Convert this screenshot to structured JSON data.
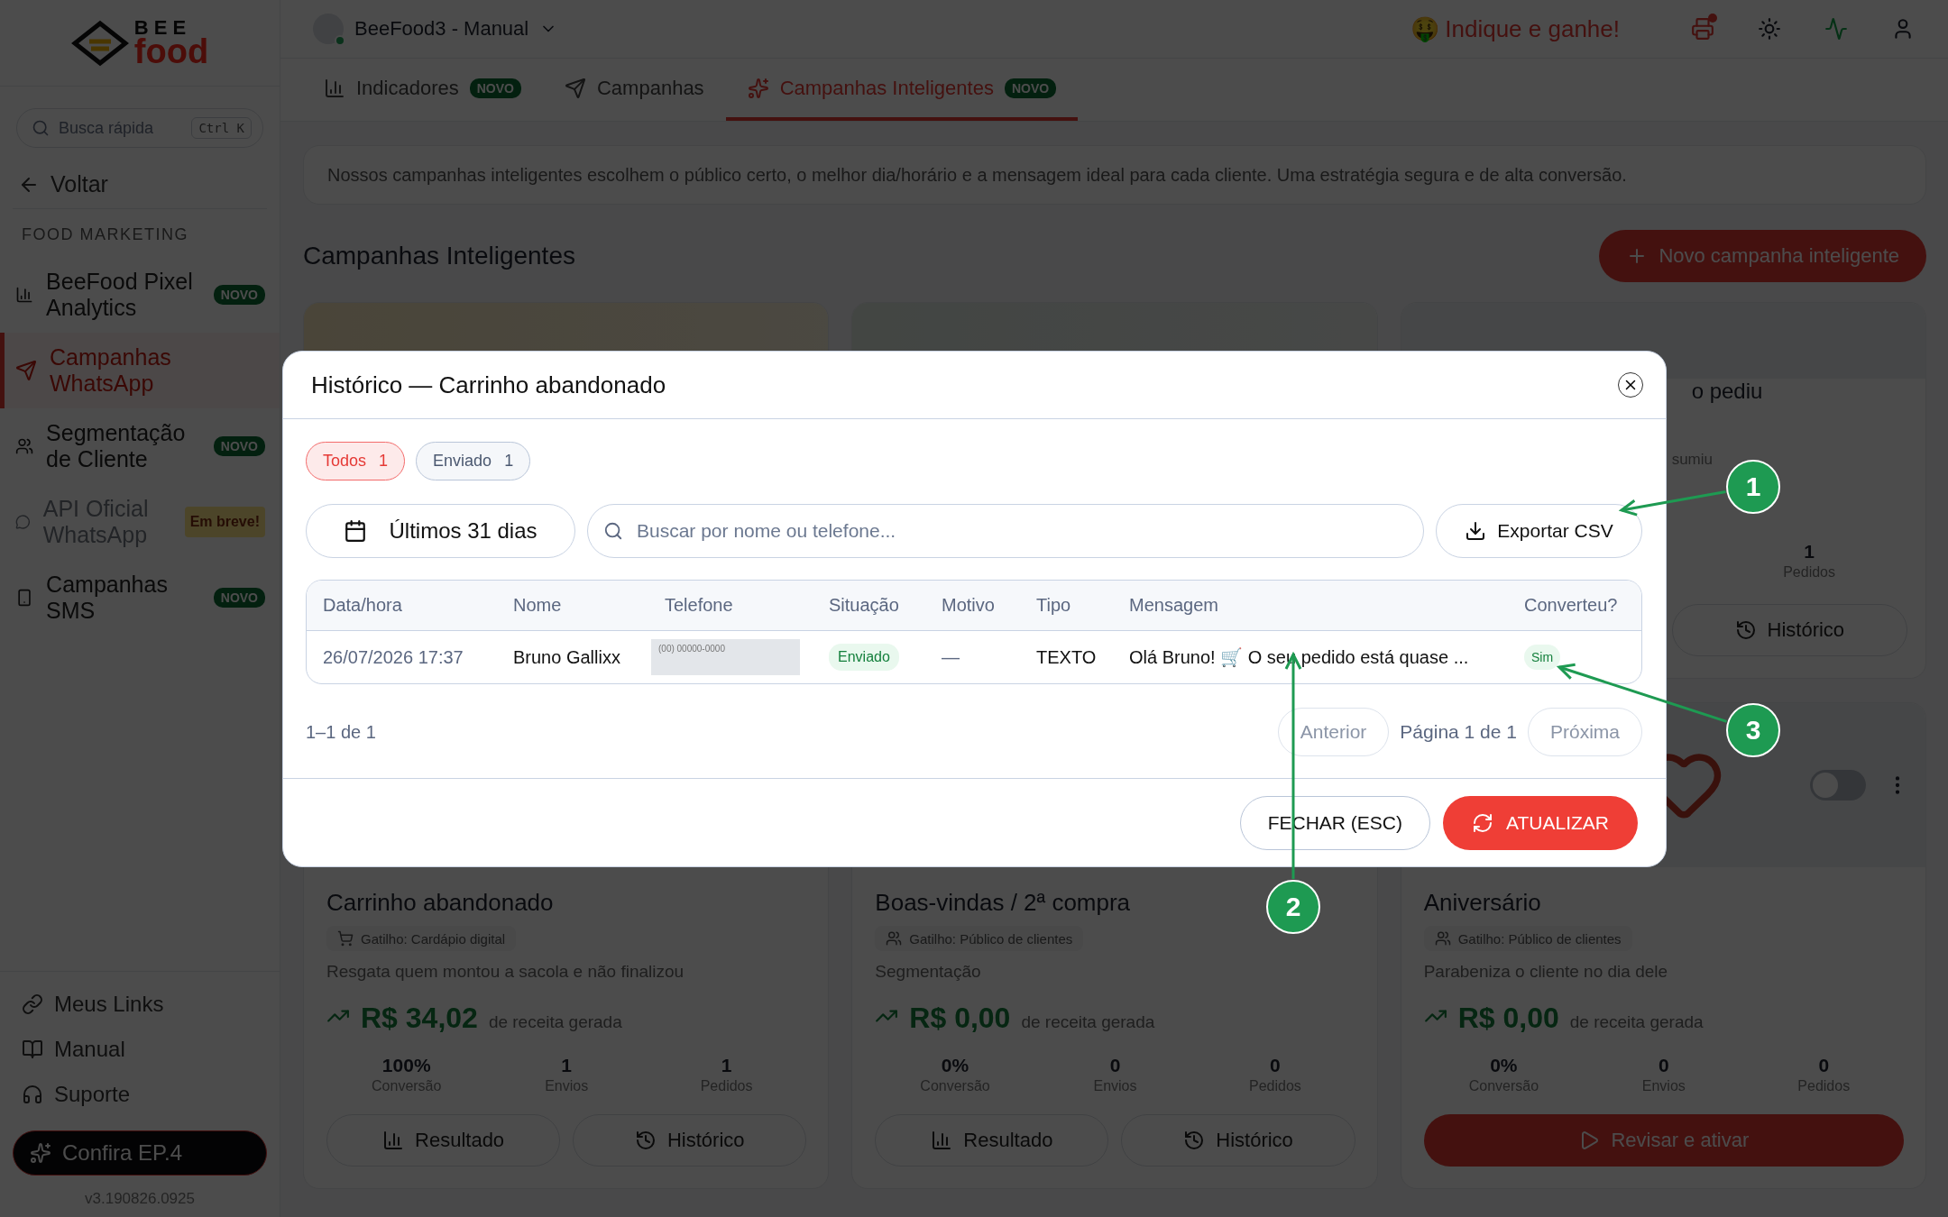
{
  "sidebar": {
    "logo": {
      "line_1": "BEE",
      "line_2": "food"
    },
    "search": {
      "placeholder": "Busca rápida",
      "shortcut": "Ctrl K"
    },
    "back": "Voltar",
    "section": "FOOD MARKETING",
    "items": [
      {
        "label": "BeeFood Pixel Analytics",
        "badge": "NOVO",
        "selected": false,
        "disabled": false
      },
      {
        "label": "Campanhas WhatsApp",
        "selected": true,
        "disabled": false
      },
      {
        "label": "Segmentação de Cliente",
        "badge": "NOVO",
        "selected": false,
        "disabled": false
      },
      {
        "label": "API Oficial WhatsApp",
        "badge": "Em breve!",
        "selected": false,
        "disabled": true
      },
      {
        "label": "Campanhas SMS",
        "badge": "NOVO",
        "selected": false,
        "disabled": false
      }
    ],
    "footer_links": [
      {
        "label": "Meus Links"
      },
      {
        "label": "Manual"
      },
      {
        "label": "Suporte"
      }
    ],
    "promo_button": "Confira EP.4",
    "version": "v3.190826.0925"
  },
  "topbar": {
    "workspace": "BeeFood3 - Manual",
    "referral": {
      "emoji": "🤑",
      "label": "Indique e ganhe!"
    },
    "printer_alert": true
  },
  "tabs": [
    {
      "label": "Indicadores",
      "badge": "NOVO",
      "selected": false
    },
    {
      "label": "Campanhas",
      "selected": false
    },
    {
      "label": "Campanhas Inteligentes",
      "badge": "NOVO",
      "selected": true
    }
  ],
  "banner": "Nossos campanhas inteligentes escolhem o público certo, o melhor dia/horário e a mensagem ideal para cada cliente. Uma estratégia segura e de alta conversão.",
  "section_title": "Campanhas Inteligentes",
  "new_button": "Novo campanha inteligente",
  "partial_card": {
    "title": "o pediu",
    "description": "sumiu",
    "stat": {
      "value": "1",
      "label": "Pedidos"
    },
    "button": "Histórico"
  },
  "campaign_cards": [
    {
      "title": "Carrinho abandonado",
      "trigger": "Gatilho: Cardápio digital",
      "description": "Resgata quem montou a sacola e não finalizou",
      "revenue": "R$ 34,02",
      "revenue_label": "de receita gerada",
      "stats": [
        {
          "value": "100%",
          "label": "Conversão"
        },
        {
          "value": "1",
          "label": "Envios"
        },
        {
          "value": "1",
          "label": "Pedidos"
        }
      ],
      "kind": "review",
      "buttons": [
        "Resultado",
        "Histórico"
      ]
    },
    {
      "title": "Boas-vindas / 2ª compra",
      "trigger": "Gatilho: Público de clientes",
      "description": "Segmentação",
      "revenue": "R$ 0,00",
      "revenue_label": "de receita gerada",
      "stats": [
        {
          "value": "0%",
          "label": "Conversão"
        },
        {
          "value": "0",
          "label": "Envios"
        },
        {
          "value": "0",
          "label": "Pedidos"
        }
      ],
      "kind": "review",
      "buttons": [
        "Resultado",
        "Histórico"
      ]
    },
    {
      "title": "Aniversário",
      "trigger": "Gatilho: Público de clientes",
      "description": "Parabeniza o cliente no dia dele",
      "revenue": "R$ 0,00",
      "revenue_label": "de receita gerada",
      "stats": [
        {
          "value": "0%",
          "label": "Conversão"
        },
        {
          "value": "0",
          "label": "Envios"
        },
        {
          "value": "0",
          "label": "Pedidos"
        }
      ],
      "kind": "activate",
      "buttons": [
        "Revisar e ativar"
      ],
      "on": false
    }
  ],
  "modal": {
    "title": "Histórico — Carrinho abandonado",
    "filters": [
      {
        "label": "Todos",
        "count": "1",
        "selected": true
      },
      {
        "label": "Enviado",
        "count": "1",
        "selected": false
      }
    ],
    "date_range": "Últimos 31 dias",
    "search": {
      "placeholder": "Buscar por nome ou telefone..."
    },
    "export_button": "Exportar CSV",
    "table": {
      "columns": [
        "Data/hora",
        "Nome",
        "Telefone",
        "Situação",
        "Motivo",
        "Tipo",
        "Mensagem",
        "Converteu?"
      ],
      "rows": [
        {
          "datetime": "26/07/2026 17:37",
          "name": "Bruno Gallixx",
          "phone": "(00) 00000-0000",
          "status": "Enviado",
          "reason": "—",
          "type": "TEXTO",
          "message": "Olá Bruno! 🛒 O seu pedido está quase ...",
          "converted": "Sim"
        }
      ]
    },
    "range": "1–1 de 1",
    "prev": {
      "label": "Anterior",
      "disabled": true
    },
    "page": "Página 1 de 1",
    "next": {
      "label": "Próxima",
      "disabled": true
    },
    "close_button": "FECHAR (ESC)",
    "refresh_button": "ATUALIZAR"
  },
  "annotations": [
    {
      "label": "1"
    },
    {
      "label": "2"
    },
    {
      "label": "3"
    }
  ]
}
